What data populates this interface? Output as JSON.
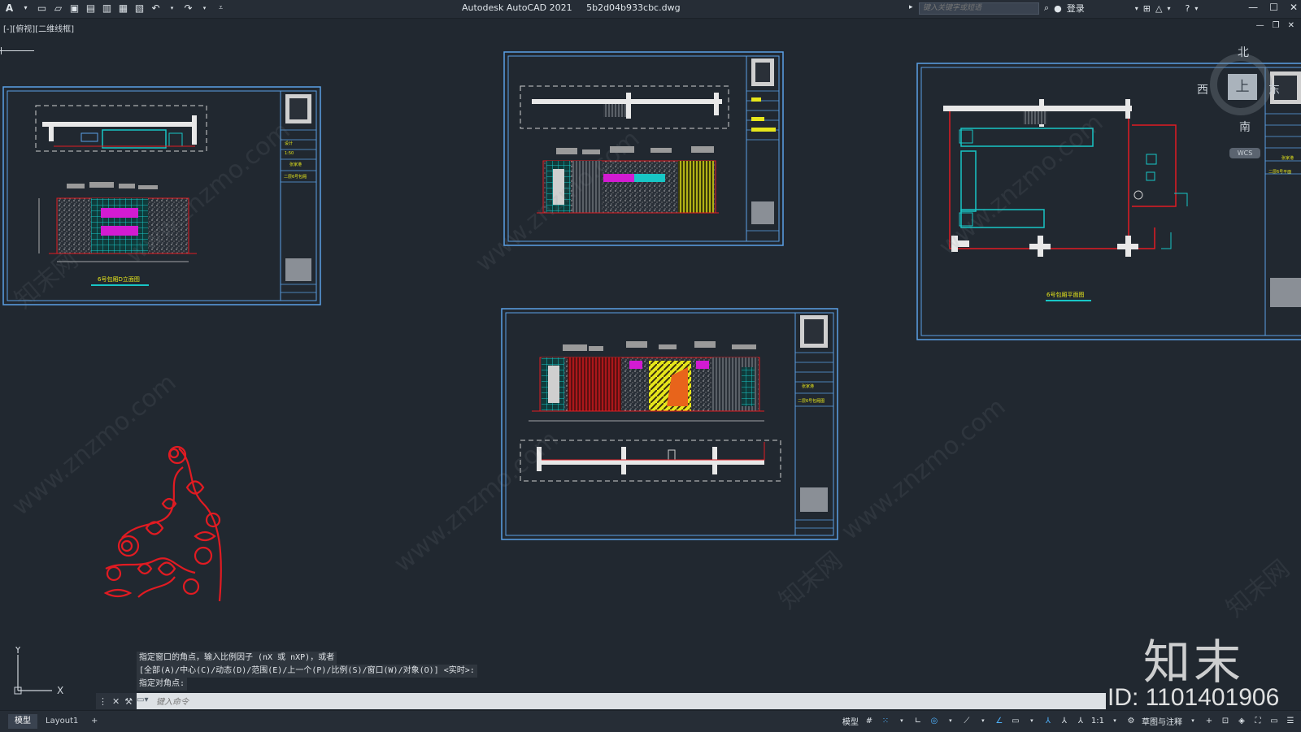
{
  "window": {
    "app_name": "Autodesk AutoCAD 2021",
    "file_name": "5b2d04b933cbc.dwg",
    "search_placeholder": "键入关键字或短语",
    "login_label": "登录"
  },
  "viewport": {
    "label": "[-][俯视][二维线框]"
  },
  "viewcube": {
    "north": "北",
    "south": "南",
    "west": "西",
    "east": "东",
    "face": "上",
    "wcs": "WCS"
  },
  "ucs": {
    "x": "X",
    "y": "Y"
  },
  "sheets": {
    "sheet1_caption": "6号包厢D立面图",
    "sheet3_caption": "6号包厢平面图",
    "tb1_a": "设计",
    "tb1_b": "1:50",
    "tb1_c": "张家港",
    "tb1_d": "二层6号包厢",
    "tb3_a": "张家港",
    "tb3_b": "二层6号包厢图",
    "tb4_a": "张家港",
    "tb4_b": "二层6号平面"
  },
  "watermarks": {
    "text": "www.znzmo.com",
    "cn": "知末网"
  },
  "command": {
    "history": [
      "指定窗口的角点，输入比例因子 (nX 或 nXP)，或者",
      "[全部(A)/中心(C)/动态(D)/范围(E)/上一个(P)/比例(S)/窗口(W)/对象(O)] <实时>:",
      "指定对角点:"
    ],
    "placeholder": "键入命令"
  },
  "tabs": {
    "model": "模型",
    "layout1": "Layout1",
    "add": "+"
  },
  "status": {
    "model_label": "模型",
    "scale": "1:1",
    "workspace": "草图与注释"
  },
  "brand": {
    "logo_text": "知末",
    "id_text": "ID: 1101401906"
  },
  "colors": {
    "background": "#212830",
    "frame": "#5aa0e6",
    "red": "#e11b22",
    "cyan": "#18c6c6",
    "magenta": "#d21bd2",
    "yellow": "#e6e61b"
  },
  "icons": {
    "new": "new-file-icon",
    "open": "open-folder-icon",
    "save": "save-icon",
    "save_as": "save-as-icon",
    "plot": "print-icon",
    "undo": "undo-icon",
    "redo": "redo-icon"
  }
}
